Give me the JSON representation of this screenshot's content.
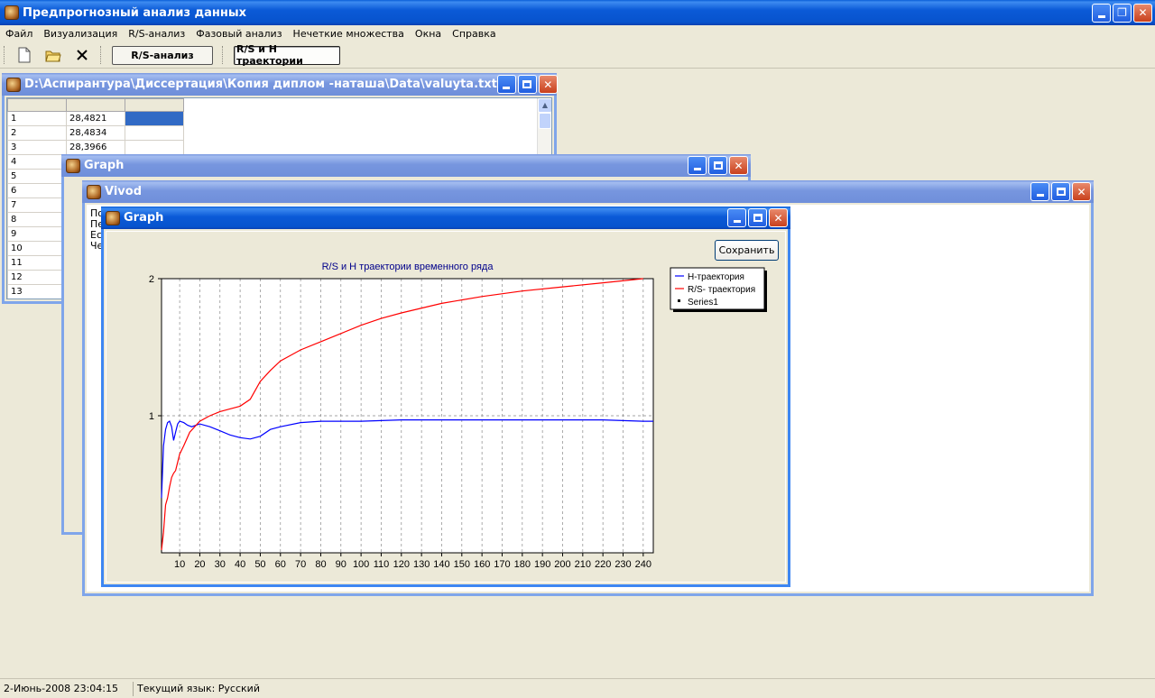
{
  "app": {
    "title": "Предпрогнозный анализ данных"
  },
  "menu": [
    "Файл",
    "Визуализация",
    "R/S-анализ",
    "Фазовый анализ",
    "Нечеткие множества",
    "Окна",
    "Справка"
  ],
  "toolbar": {
    "rs_button": "R/S-анализ",
    "traj_button": "R/S и H траектории"
  },
  "data_window": {
    "title": "D:\\Аспирантура\\Диссертация\\Копия диплом -наташа\\Data\\valuyta.txt",
    "rows": [
      "1",
      "2",
      "3",
      "4",
      "5",
      "6",
      "7",
      "8",
      "9",
      "10",
      "11",
      "12",
      "13"
    ],
    "values": [
      "28,4821",
      "28,4834",
      "28,3966"
    ]
  },
  "graph_window_back": {
    "title": "Graph"
  },
  "vivod_window": {
    "title": "Vivod",
    "lines": [
      "По",
      "Пе",
      "Ес",
      "Че"
    ]
  },
  "graph_window": {
    "title": "Graph",
    "save_button": "Сохранить"
  },
  "chart_data": {
    "type": "line",
    "title": "R/S и H траектории временного ряда",
    "xlabel": "",
    "ylabel": "",
    "xlim": [
      1,
      245
    ],
    "ylim": [
      0,
      2
    ],
    "xticks": [
      10,
      20,
      30,
      40,
      50,
      60,
      70,
      80,
      90,
      100,
      110,
      120,
      130,
      140,
      150,
      160,
      170,
      180,
      190,
      200,
      210,
      220,
      230,
      240
    ],
    "yticks": [
      1,
      2
    ],
    "grid": "vertical dashed, horizontal dashed at y=1",
    "legend": "top-right",
    "series": [
      {
        "name": "H-траектория",
        "color": "#0000ff",
        "x": [
          1,
          2,
          3,
          4,
          5,
          6,
          7,
          8,
          9,
          10,
          12,
          14,
          16,
          18,
          20,
          25,
          30,
          35,
          40,
          45,
          50,
          55,
          60,
          70,
          80,
          90,
          100,
          120,
          140,
          160,
          180,
          200,
          220,
          240,
          245
        ],
        "y": [
          0.4,
          0.78,
          0.9,
          0.95,
          0.96,
          0.92,
          0.82,
          0.88,
          0.94,
          0.96,
          0.95,
          0.93,
          0.92,
          0.93,
          0.94,
          0.92,
          0.89,
          0.86,
          0.84,
          0.83,
          0.85,
          0.9,
          0.92,
          0.95,
          0.96,
          0.96,
          0.96,
          0.97,
          0.97,
          0.97,
          0.97,
          0.97,
          0.97,
          0.96,
          0.96
        ]
      },
      {
        "name": "R/S- траектория",
        "color": "#ff0000",
        "x": [
          1,
          2,
          3,
          4,
          5,
          6,
          7,
          8,
          10,
          12,
          15,
          20,
          25,
          30,
          35,
          40,
          45,
          50,
          55,
          60,
          70,
          80,
          90,
          100,
          110,
          120,
          140,
          160,
          180,
          200,
          220,
          240
        ],
        "y": [
          0.02,
          0.15,
          0.35,
          0.4,
          0.48,
          0.55,
          0.58,
          0.6,
          0.72,
          0.78,
          0.88,
          0.96,
          1.0,
          1.03,
          1.05,
          1.07,
          1.12,
          1.25,
          1.33,
          1.4,
          1.48,
          1.54,
          1.6,
          1.66,
          1.71,
          1.75,
          1.82,
          1.87,
          1.91,
          1.94,
          1.97,
          2.0
        ]
      },
      {
        "name": "Series1",
        "color": "#000000",
        "x": [],
        "y": []
      }
    ]
  },
  "status": {
    "datetime": "2-Июнь-2008 23:04:15",
    "language": "Текущий язык: Русский"
  }
}
